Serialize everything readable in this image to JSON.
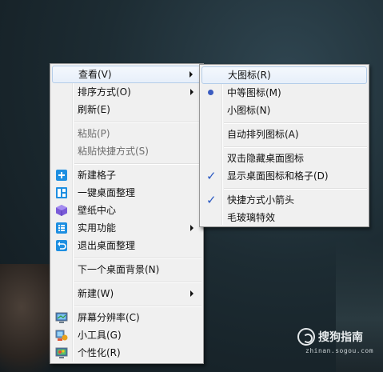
{
  "context_menu": {
    "items": [
      {
        "label": "查看(V)",
        "submenu": true,
        "hover": true
      },
      {
        "label": "排序方式(O)",
        "submenu": true
      },
      {
        "label": "刷新(E)"
      },
      {
        "label": "粘贴(P)",
        "disabled": true
      },
      {
        "label": "粘贴快捷方式(S)",
        "disabled": true
      },
      {
        "label": "新建格子",
        "icon": "add-grid-icon"
      },
      {
        "label": "一键桌面整理",
        "icon": "layout-grid-icon"
      },
      {
        "label": "壁纸中心",
        "icon": "wallpaper-cube-icon"
      },
      {
        "label": "实用功能",
        "icon": "list-icon",
        "submenu": true
      },
      {
        "label": "退出桌面整理",
        "icon": "undo-icon"
      },
      {
        "label": "下一个桌面背景(N)"
      },
      {
        "label": "新建(W)",
        "submenu": true
      },
      {
        "label": "屏幕分辨率(C)",
        "icon": "screen-resolution-icon"
      },
      {
        "label": "小工具(G)",
        "icon": "gadgets-icon"
      },
      {
        "label": "个性化(R)",
        "icon": "personalize-icon"
      }
    ]
  },
  "view_submenu": {
    "items": [
      {
        "label": "大图标(R)",
        "hover": true
      },
      {
        "label": "中等图标(M)",
        "mark": "radio"
      },
      {
        "label": "小图标(N)"
      },
      {
        "label": "自动排列图标(A)"
      },
      {
        "label": "双击隐藏桌面图标"
      },
      {
        "label": "显示桌面图标和格子(D)",
        "mark": "check"
      },
      {
        "label": "快捷方式小箭头",
        "mark": "check"
      },
      {
        "label": "毛玻璃特效"
      }
    ]
  },
  "watermark": {
    "title": "搜狗指南",
    "url": "zhinan.sogou.com"
  },
  "colors": {
    "menu_bg": "#f0f0f0",
    "menu_border": "#979797",
    "highlight_border": "#b4cde9",
    "check": "#2a59c2",
    "icon_blue": "#1e8fe1",
    "icon_purple": "#7a5bd8"
  }
}
